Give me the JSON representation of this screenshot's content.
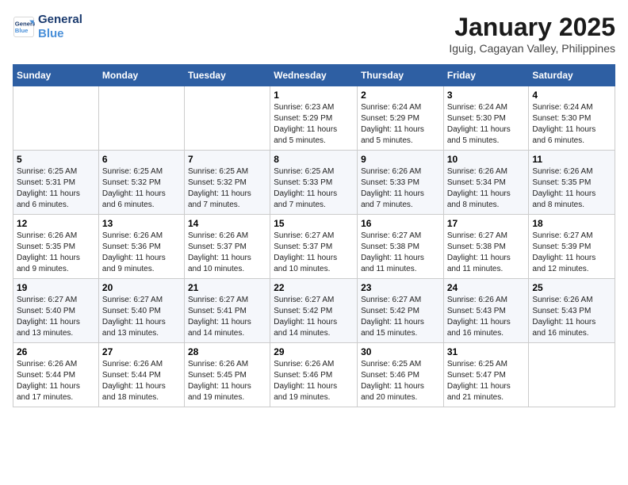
{
  "header": {
    "logo_line1": "General",
    "logo_line2": "Blue",
    "month": "January 2025",
    "location": "Iguig, Cagayan Valley, Philippines"
  },
  "days_of_week": [
    "Sunday",
    "Monday",
    "Tuesday",
    "Wednesday",
    "Thursday",
    "Friday",
    "Saturday"
  ],
  "weeks": [
    [
      {
        "day": "",
        "info": ""
      },
      {
        "day": "",
        "info": ""
      },
      {
        "day": "",
        "info": ""
      },
      {
        "day": "1",
        "info": "Sunrise: 6:23 AM\nSunset: 5:29 PM\nDaylight: 11 hours\nand 5 minutes."
      },
      {
        "day": "2",
        "info": "Sunrise: 6:24 AM\nSunset: 5:29 PM\nDaylight: 11 hours\nand 5 minutes."
      },
      {
        "day": "3",
        "info": "Sunrise: 6:24 AM\nSunset: 5:30 PM\nDaylight: 11 hours\nand 5 minutes."
      },
      {
        "day": "4",
        "info": "Sunrise: 6:24 AM\nSunset: 5:30 PM\nDaylight: 11 hours\nand 6 minutes."
      }
    ],
    [
      {
        "day": "5",
        "info": "Sunrise: 6:25 AM\nSunset: 5:31 PM\nDaylight: 11 hours\nand 6 minutes."
      },
      {
        "day": "6",
        "info": "Sunrise: 6:25 AM\nSunset: 5:32 PM\nDaylight: 11 hours\nand 6 minutes."
      },
      {
        "day": "7",
        "info": "Sunrise: 6:25 AM\nSunset: 5:32 PM\nDaylight: 11 hours\nand 7 minutes."
      },
      {
        "day": "8",
        "info": "Sunrise: 6:25 AM\nSunset: 5:33 PM\nDaylight: 11 hours\nand 7 minutes."
      },
      {
        "day": "9",
        "info": "Sunrise: 6:26 AM\nSunset: 5:33 PM\nDaylight: 11 hours\nand 7 minutes."
      },
      {
        "day": "10",
        "info": "Sunrise: 6:26 AM\nSunset: 5:34 PM\nDaylight: 11 hours\nand 8 minutes."
      },
      {
        "day": "11",
        "info": "Sunrise: 6:26 AM\nSunset: 5:35 PM\nDaylight: 11 hours\nand 8 minutes."
      }
    ],
    [
      {
        "day": "12",
        "info": "Sunrise: 6:26 AM\nSunset: 5:35 PM\nDaylight: 11 hours\nand 9 minutes."
      },
      {
        "day": "13",
        "info": "Sunrise: 6:26 AM\nSunset: 5:36 PM\nDaylight: 11 hours\nand 9 minutes."
      },
      {
        "day": "14",
        "info": "Sunrise: 6:26 AM\nSunset: 5:37 PM\nDaylight: 11 hours\nand 10 minutes."
      },
      {
        "day": "15",
        "info": "Sunrise: 6:27 AM\nSunset: 5:37 PM\nDaylight: 11 hours\nand 10 minutes."
      },
      {
        "day": "16",
        "info": "Sunrise: 6:27 AM\nSunset: 5:38 PM\nDaylight: 11 hours\nand 11 minutes."
      },
      {
        "day": "17",
        "info": "Sunrise: 6:27 AM\nSunset: 5:38 PM\nDaylight: 11 hours\nand 11 minutes."
      },
      {
        "day": "18",
        "info": "Sunrise: 6:27 AM\nSunset: 5:39 PM\nDaylight: 11 hours\nand 12 minutes."
      }
    ],
    [
      {
        "day": "19",
        "info": "Sunrise: 6:27 AM\nSunset: 5:40 PM\nDaylight: 11 hours\nand 13 minutes."
      },
      {
        "day": "20",
        "info": "Sunrise: 6:27 AM\nSunset: 5:40 PM\nDaylight: 11 hours\nand 13 minutes."
      },
      {
        "day": "21",
        "info": "Sunrise: 6:27 AM\nSunset: 5:41 PM\nDaylight: 11 hours\nand 14 minutes."
      },
      {
        "day": "22",
        "info": "Sunrise: 6:27 AM\nSunset: 5:42 PM\nDaylight: 11 hours\nand 14 minutes."
      },
      {
        "day": "23",
        "info": "Sunrise: 6:27 AM\nSunset: 5:42 PM\nDaylight: 11 hours\nand 15 minutes."
      },
      {
        "day": "24",
        "info": "Sunrise: 6:26 AM\nSunset: 5:43 PM\nDaylight: 11 hours\nand 16 minutes."
      },
      {
        "day": "25",
        "info": "Sunrise: 6:26 AM\nSunset: 5:43 PM\nDaylight: 11 hours\nand 16 minutes."
      }
    ],
    [
      {
        "day": "26",
        "info": "Sunrise: 6:26 AM\nSunset: 5:44 PM\nDaylight: 11 hours\nand 17 minutes."
      },
      {
        "day": "27",
        "info": "Sunrise: 6:26 AM\nSunset: 5:44 PM\nDaylight: 11 hours\nand 18 minutes."
      },
      {
        "day": "28",
        "info": "Sunrise: 6:26 AM\nSunset: 5:45 PM\nDaylight: 11 hours\nand 19 minutes."
      },
      {
        "day": "29",
        "info": "Sunrise: 6:26 AM\nSunset: 5:46 PM\nDaylight: 11 hours\nand 19 minutes."
      },
      {
        "day": "30",
        "info": "Sunrise: 6:25 AM\nSunset: 5:46 PM\nDaylight: 11 hours\nand 20 minutes."
      },
      {
        "day": "31",
        "info": "Sunrise: 6:25 AM\nSunset: 5:47 PM\nDaylight: 11 hours\nand 21 minutes."
      },
      {
        "day": "",
        "info": ""
      }
    ]
  ]
}
